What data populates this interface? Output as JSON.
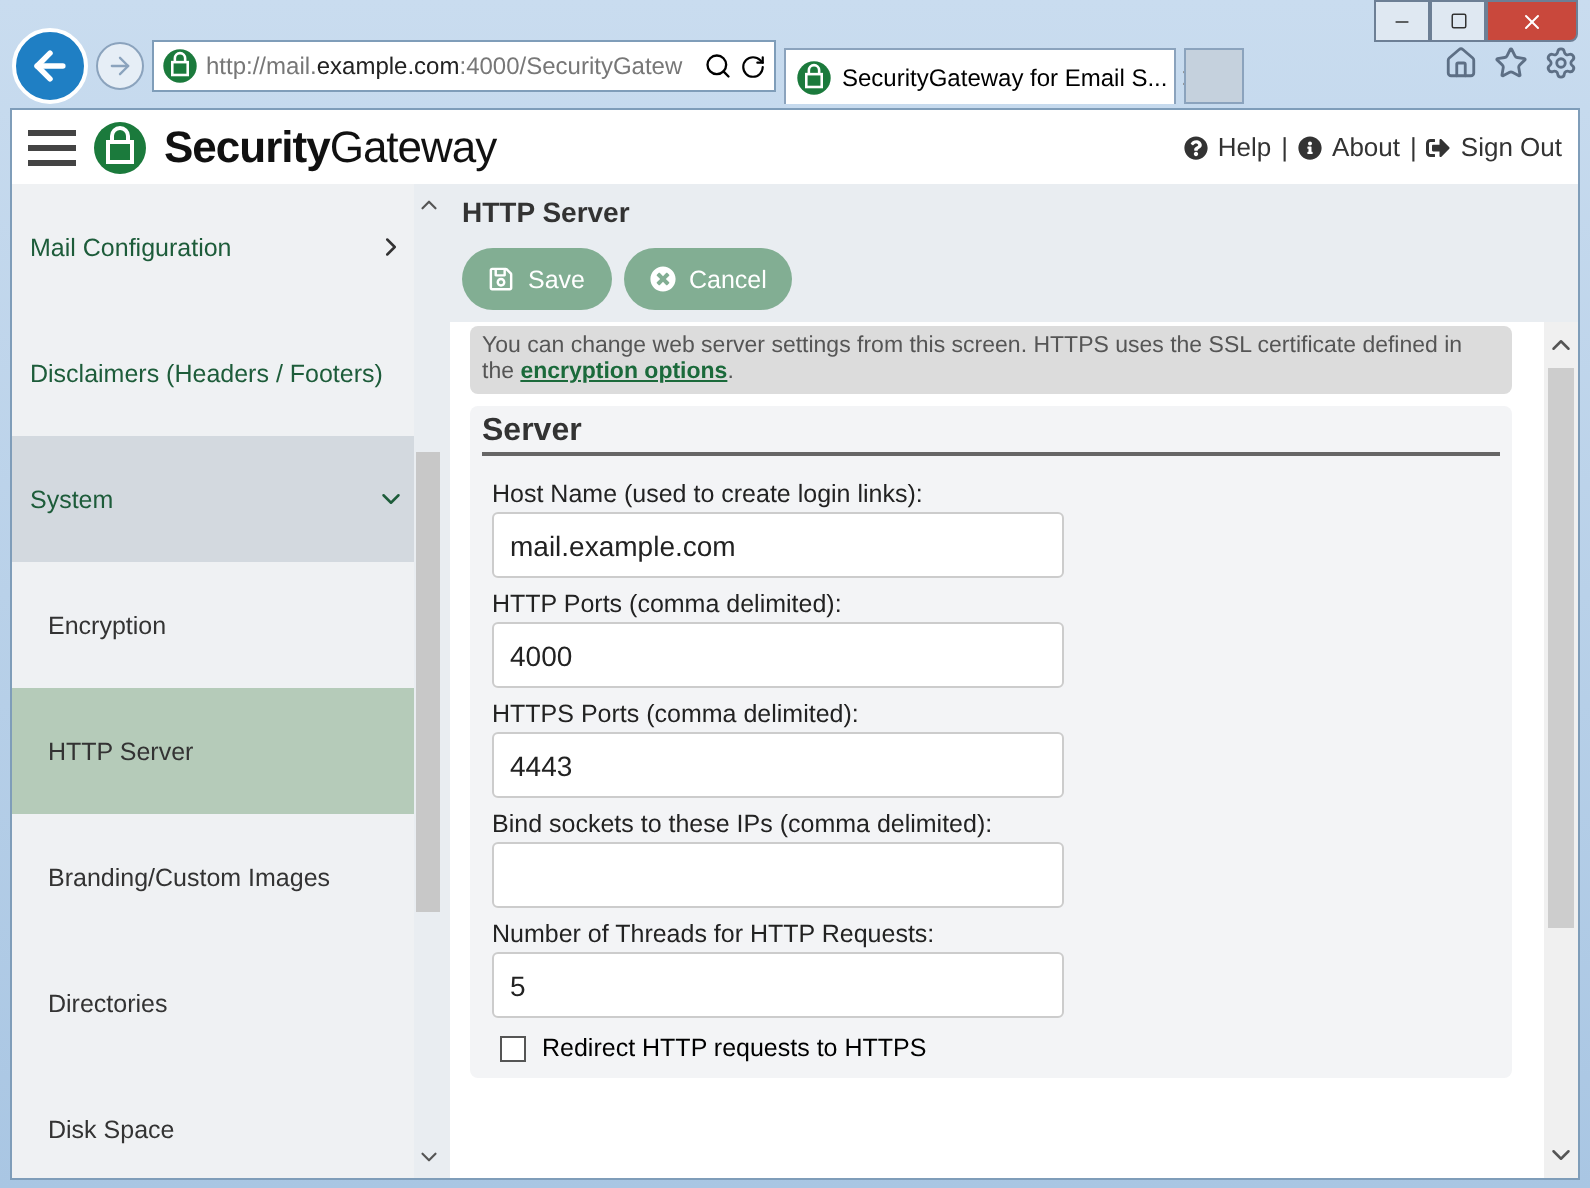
{
  "browser": {
    "address": {
      "prefix": "http://mail.",
      "host": "example.com",
      "suffix": ":4000/SecurityGatew"
    },
    "tab_title": "SecurityGateway for Email S..."
  },
  "header": {
    "logo_bold": "Security",
    "logo_light": "Gateway",
    "links": [
      {
        "label": "Help"
      },
      {
        "label": "About"
      },
      {
        "label": "Sign Out"
      }
    ],
    "separator": "|"
  },
  "sidebar": {
    "items": [
      {
        "label": "Mail Configuration",
        "kind": "group",
        "expanded": false,
        "selected": false
      },
      {
        "label": "Disclaimers (Headers / Footers)",
        "kind": "group",
        "selected": false
      },
      {
        "label": "System",
        "kind": "group",
        "expanded": true,
        "selected": false
      },
      {
        "label": "Encryption",
        "kind": "sub",
        "selected": false
      },
      {
        "label": "HTTP Server",
        "kind": "sub",
        "selected": true
      },
      {
        "label": "Branding/Custom Images",
        "kind": "sub",
        "selected": false
      },
      {
        "label": "Directories",
        "kind": "sub",
        "selected": false
      },
      {
        "label": "Disk Space",
        "kind": "sub",
        "selected": false
      }
    ]
  },
  "page": {
    "title": "HTTP Server",
    "buttons": [
      {
        "label": "Save"
      },
      {
        "label": "Cancel"
      }
    ],
    "notice": {
      "text": "You can change web server settings from this screen. HTTPS uses the SSL certificate defined in the ",
      "link": "encryption options",
      "end": "."
    },
    "section": {
      "title": "Server",
      "fields": [
        {
          "label": "Host Name (used to create login links):",
          "value": "mail.example.com"
        },
        {
          "label": "HTTP Ports (comma delimited):",
          "value": "4000"
        },
        {
          "label": "HTTPS Ports (comma delimited):",
          "value": "4443"
        },
        {
          "label": "Bind sockets to these IPs (comma delimited):"
        },
        {
          "label": "Number of Threads for HTTP Requests:",
          "value": "5"
        }
      ],
      "checkbox": {
        "label": "Redirect HTTP requests to HTTPS",
        "checked": false
      }
    }
  }
}
